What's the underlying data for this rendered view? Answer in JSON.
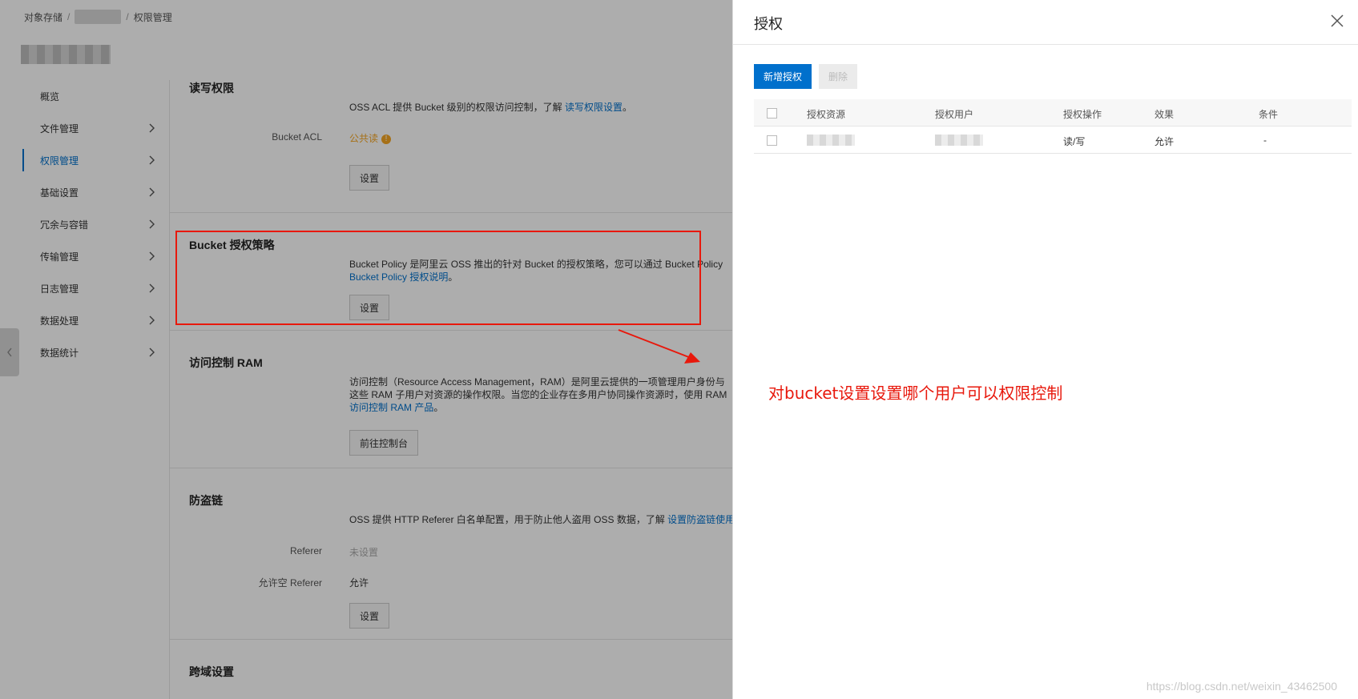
{
  "breadcrumb": {
    "root": "对象存储",
    "sep": "/",
    "current": "权限管理"
  },
  "sidebar": {
    "items": [
      {
        "label": "概览",
        "chevron": false
      },
      {
        "label": "文件管理",
        "chevron": true
      },
      {
        "label": "权限管理",
        "chevron": true,
        "active": true
      },
      {
        "label": "基础设置",
        "chevron": true
      },
      {
        "label": "冗余与容错",
        "chevron": true
      },
      {
        "label": "传输管理",
        "chevron": true
      },
      {
        "label": "日志管理",
        "chevron": true
      },
      {
        "label": "数据处理",
        "chevron": true
      },
      {
        "label": "数据统计",
        "chevron": true
      }
    ]
  },
  "sections": {
    "acl": {
      "title": "读写权限",
      "desc_prefix": "OSS ACL 提供 Bucket 级别的权限访问控制，了解",
      "desc_link": "读写权限设置",
      "desc_suffix": "。",
      "label": "Bucket ACL",
      "value": "公共读",
      "button": "设置"
    },
    "policy": {
      "title": "Bucket 授权策略",
      "desc_line1": "Bucket Policy 是阿里云 OSS 推出的针对 Bucket 的授权策略，您可以通过 Bucket Policy",
      "desc_link": "Bucket Policy 授权说明",
      "desc_suffix": "。",
      "button": "设置"
    },
    "ram": {
      "title": "访问控制 RAM",
      "desc_line1": "访问控制（Resource Access Management，RAM）是阿里云提供的一项管理用户身份与",
      "desc_line2": "这些 RAM 子用户对资源的操作权限。当您的企业存在多用户协同操作资源时，使用 RAM",
      "desc_link": "访问控制 RAM 产品",
      "desc_suffix": "。",
      "button": "前往控制台"
    },
    "referer": {
      "title": "防盗链",
      "desc_prefix": "OSS 提供 HTTP Referer 白名单配置，用于防止他人盗用 OSS 数据，了解",
      "desc_link": "设置防盗链使用",
      "label1": "Referer",
      "value1": "未设置",
      "label2": "允许空 Referer",
      "value2": "允许",
      "button": "设置"
    },
    "cors": {
      "title": "跨域设置"
    }
  },
  "drawer": {
    "title": "授权",
    "add_button": "新增授权",
    "delete_button": "删除",
    "columns": [
      "授权资源",
      "授权用户",
      "授权操作",
      "效果",
      "条件"
    ],
    "rows": [
      {
        "operation": "读/写",
        "effect": "允许",
        "condition": "-"
      }
    ]
  },
  "annotation": "对bucket设置设置哪个用户可以权限控制",
  "watermark": "https://blog.csdn.net/weixin_43462500",
  "colors": {
    "accent": "#0070cc",
    "annotation": "#e8180c",
    "warning": "#f5a623"
  }
}
